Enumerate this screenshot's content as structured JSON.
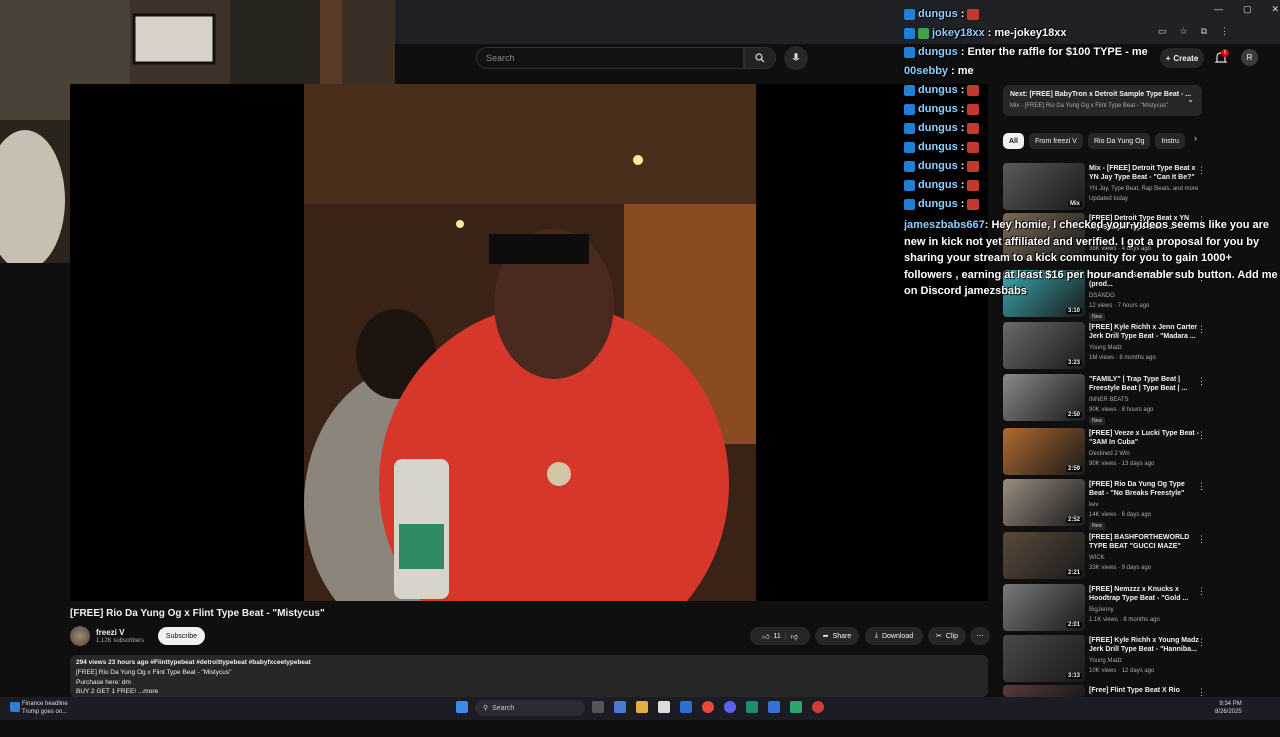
{
  "header": {
    "search_placeholder": "Search",
    "create_label": "Create",
    "notif_count": "6",
    "avatar_initial": "R"
  },
  "chat": {
    "lines": [
      {
        "user": "dungus",
        "msg": ":"
      },
      {
        "user": "jokey18xx",
        "msg": ": me-jokey18xx"
      },
      {
        "user": "dungus",
        "msg": ": Enter the raffle for $100 TYPE - me"
      },
      {
        "user": "00sebby",
        "msg": ": me"
      },
      {
        "user": "dungus",
        "msg": ":"
      },
      {
        "user": "dungus",
        "msg": ":"
      },
      {
        "user": "dungus",
        "msg": ":"
      },
      {
        "user": "dungus",
        "msg": ":"
      },
      {
        "user": "dungus",
        "msg": ":"
      },
      {
        "user": "dungus",
        "msg": ":"
      },
      {
        "user": "dungus",
        "msg": ":"
      }
    ],
    "long_user": "jameszbabs667",
    "long_msg": ": Hey homie, I checked your videos seems like you are new in kick not yet affiliated and verified. I got a proposal for you by sharing your stream to a kick community for you to gain 1000+ followers , earning at least $16 per hour and enable sub button. Add me on Discord jamezsbabs"
  },
  "next": {
    "line1": "Next: [FREE] BabyTron x Detroit Sample Type Beat - ...",
    "line2": "Mix - [FREE] Rio Da Yung Og x Flint Type Beat - \"Mistycus\""
  },
  "chips": [
    "All",
    "From freezi V",
    "Rio Da Yung Og",
    "Instru"
  ],
  "recs": [
    {
      "title": "Mix - [FREE] Detroit Type Beat x YN Jay Type Beat - \"Can It Be?\"",
      "meta1": "YN Jay, Type Beat, Rap Beats, and more",
      "meta2": "Updated today",
      "dur": "Mix",
      "color": "#5a5a5a"
    },
    {
      "title": "[FREE] Detroit Type Beat x YN Jay Sample Type Beat - ...",
      "meta1": "...",
      "meta2": "38K views · 4 days ago",
      "dur": "",
      "color": "#7a6a55"
    },
    {
      "title": "Type Beat - \"Six Shooter\" (prod...",
      "meta1": "DSANDO",
      "meta2": "12 views · 7 hours ago",
      "dur": "3:10",
      "new": "New",
      "color": "#3aa8b0"
    },
    {
      "title": "[FREE] Kyle Richh x Jenn Carter Jerk Drill Type Beat - \"Madara ...",
      "meta1": "Young Madz",
      "meta2": "1M views · 8 months ago",
      "dur": "3:23",
      "color": "#6a6a6a"
    },
    {
      "title": "\"FAMILY\" | Trap Type Beat | Freestyle Beat | Type Beat | ...",
      "meta1": "INNER BEATS",
      "meta2": "90K views · 8 hours ago",
      "dur": "2:50",
      "new": "New",
      "color": "#8a8a8a"
    },
    {
      "title": "[FREE] Veeze x Lucki Type Beat - \"3AM In Cuba\"",
      "meta1": "Destined 2 Win",
      "meta2": "90K views · 13 days ago",
      "dur": "2:59",
      "color": "#b06a30"
    },
    {
      "title": "[FREE] Rio Da Yung Og Type Beat - \"No Breaks Freestyle\"",
      "meta1": "kev",
      "meta2": "14K views · 6 days ago",
      "dur": "2:52",
      "new": "New",
      "color": "#9a8e80"
    },
    {
      "title": "[FREE] BASHFORTHEWORLD TYPE BEAT \"GUCCI MAZE\"",
      "meta1": "WICK",
      "meta2": "33K views · 9 days ago",
      "dur": "2:21",
      "color": "#5a4a3a"
    },
    {
      "title": "[FREE] Nemzzz x Knucks x Hoodtrap Type Beat - \"Gold ...",
      "meta1": "BigJenny",
      "meta2": "1.1K views · 8 months ago",
      "dur": "2:01",
      "color": "#7a7a7a"
    },
    {
      "title": "[FREE] Kyle Richh x Young Madz Jerk Drill Type Beat - \"Hanniba...",
      "meta1": "Young Madz",
      "meta2": "10K views · 12 days ago",
      "dur": "3:13",
      "color": "#4a4a4a"
    },
    {
      "title": "[Free] Flint Type Beat X Rio",
      "meta1": "",
      "meta2": "",
      "dur": "",
      "color": "#5a3a3a"
    }
  ],
  "video": {
    "title": "[FREE] Rio Da Yung Og x Flint Type Beat - \"Mistycus\"",
    "channel": "freezi V",
    "subs": "1.12K subscribers",
    "subscribe": "Subscribe",
    "likes": "11",
    "share": "Share",
    "download": "Download",
    "clip": "Clip",
    "desc_line1": "294 views  23 hours ago  #Flinttypebeat #detroittypebeat #babyfxceetypebeat",
    "desc_line2": "[FREE] Rio Da Yung Og x Flint Type Beat - \"Mistycus\"",
    "desc_line3": "Purchase here: dm",
    "desc_line4": "BUY 2 GET 1 FREE!  ...more"
  },
  "taskbar": {
    "news1": "Finance headline",
    "news2": "Trump goes on...",
    "search": "Search",
    "time": "9:34 PM",
    "date": "8/26/2025"
  },
  "colors": {
    "accent": "#f1f1f1",
    "badge": "#1f7fd6",
    "notif": "#cc0000"
  }
}
